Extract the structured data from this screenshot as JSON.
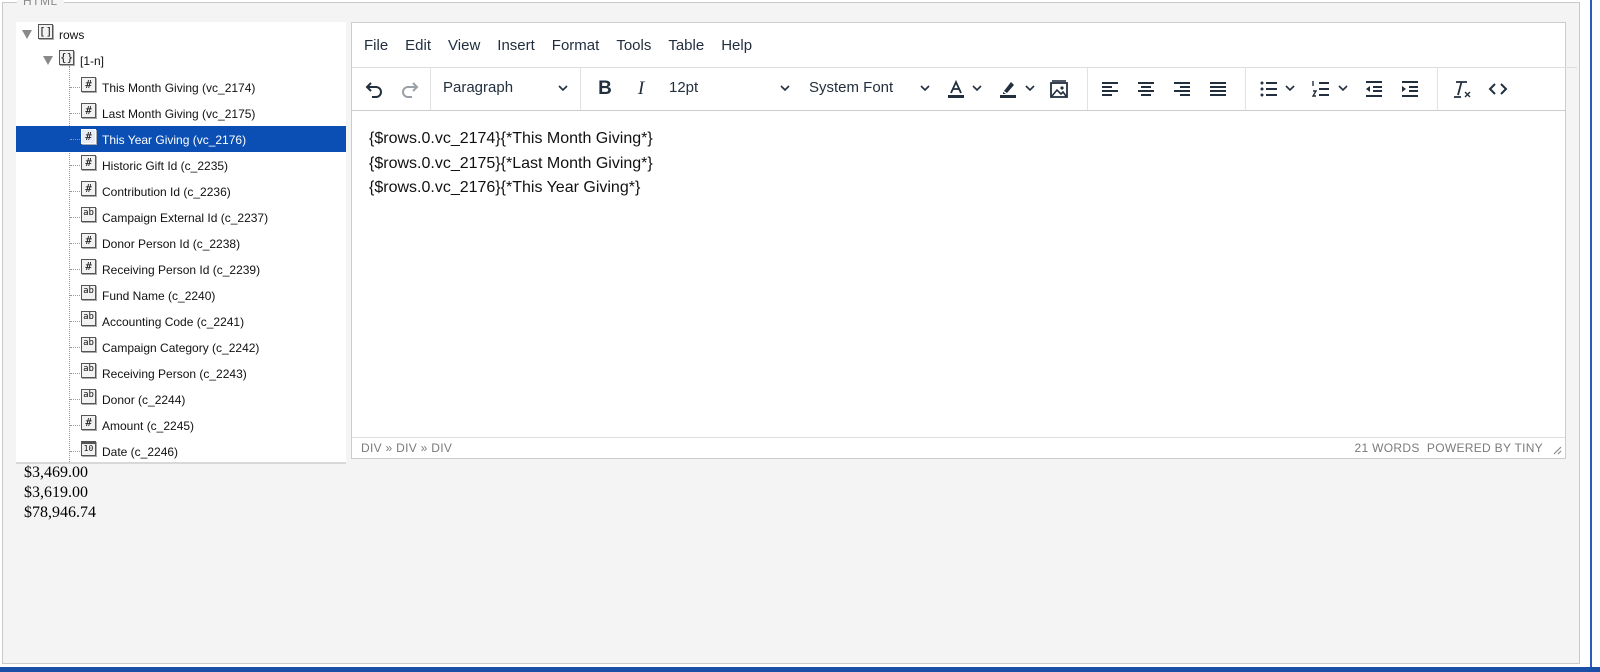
{
  "fieldset": {
    "legend": "HTML"
  },
  "tree": {
    "root": {
      "label": "rows",
      "type_icon": "[]"
    },
    "group": {
      "label": "[1-n]",
      "type_icon": "{}"
    },
    "items": [
      {
        "label": "This Month Giving (vc_2174)",
        "type": "number",
        "selected": false
      },
      {
        "label": "Last Month Giving (vc_2175)",
        "type": "number",
        "selected": false
      },
      {
        "label": "This Year Giving (vc_2176)",
        "type": "number",
        "selected": true
      },
      {
        "label": "Historic Gift Id (c_2235)",
        "type": "number",
        "selected": false
      },
      {
        "label": "Contribution Id (c_2236)",
        "type": "number",
        "selected": false
      },
      {
        "label": "Campaign External Id (c_2237)",
        "type": "text",
        "selected": false
      },
      {
        "label": "Donor Person Id (c_2238)",
        "type": "number",
        "selected": false
      },
      {
        "label": "Receiving Person Id (c_2239)",
        "type": "number",
        "selected": false
      },
      {
        "label": "Fund Name (c_2240)",
        "type": "text",
        "selected": false
      },
      {
        "label": "Accounting Code (c_2241)",
        "type": "text",
        "selected": false
      },
      {
        "label": "Campaign Category (c_2242)",
        "type": "text",
        "selected": false
      },
      {
        "label": "Receiving Person (c_2243)",
        "type": "text",
        "selected": false
      },
      {
        "label": "Donor (c_2244)",
        "type": "text",
        "selected": false
      },
      {
        "label": "Amount (c_2245)",
        "type": "number",
        "selected": false
      },
      {
        "label": "Date (c_2246)",
        "type": "date",
        "selected": false
      }
    ],
    "icon_glyphs": {
      "number": "#",
      "text": "ab",
      "date": "10"
    }
  },
  "editor": {
    "menu": [
      "File",
      "Edit",
      "View",
      "Insert",
      "Format",
      "Tools",
      "Table",
      "Help"
    ],
    "toolbar": {
      "block_format": "Paragraph",
      "font_size": "12pt",
      "font_family": "System Font",
      "icons": [
        "undo-icon",
        "redo-icon",
        "bold-icon",
        "italic-icon",
        "text-color-icon",
        "highlight-icon",
        "image-icon",
        "align-left-icon",
        "align-center-icon",
        "align-right-icon",
        "justify-icon",
        "bullet-list-icon",
        "numbered-list-icon",
        "outdent-icon",
        "indent-icon",
        "clear-formatting-icon",
        "source-code-icon"
      ]
    },
    "content_lines": [
      "{$rows.0.vc_2174}{*This Month Giving*}",
      "{$rows.0.vc_2175}{*Last Month Giving*}",
      "{$rows.0.vc_2176}{*This Year Giving*}"
    ],
    "status": {
      "path": "DIV » DIV » DIV",
      "wordcount": "21 WORDS",
      "powered_by": "POWERED BY TINY"
    }
  },
  "preview": {
    "lines": [
      "$3,469.00",
      "$3,619.00",
      "$78,946.74"
    ]
  },
  "colors": {
    "selection": "#0b4fb5",
    "accent_bar": "#1a4fa8",
    "toolbar_icon": "#222f3e"
  }
}
